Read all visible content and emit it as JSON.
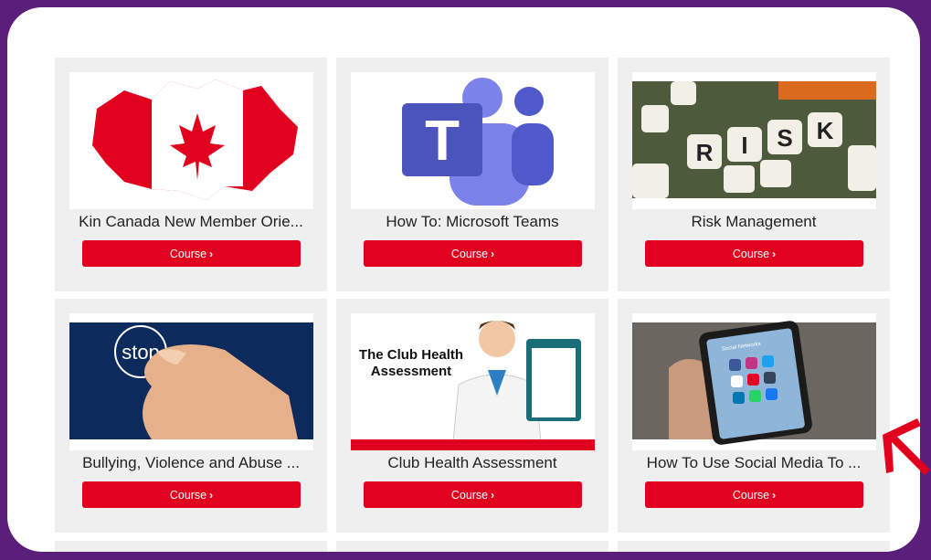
{
  "cards": [
    {
      "title": "Kin Canada New Member Orie...",
      "button": "Course",
      "thumb_icon": "canada-map-flag-image"
    },
    {
      "title": "How To: Microsoft Teams",
      "button": "Course",
      "thumb_icon": "microsoft-teams-logo-image"
    },
    {
      "title": "Risk Management",
      "button": "Course",
      "thumb_icon": "risk-dice-image"
    },
    {
      "title": "Bullying, Violence and Abuse ...",
      "button": "Course",
      "thumb_icon": "stop-finger-image"
    },
    {
      "title": "Club Health Assessment",
      "button": "Course",
      "thumb_icon": "doctor-clipboard-image"
    },
    {
      "title": "How To Use Social Media To ...",
      "button": "Course",
      "thumb_icon": "social-media-phone-image"
    }
  ],
  "thumb_text": {
    "stop": "stop",
    "club_health_line1": "The Club Health",
    "club_health_line2": "Assessment",
    "dice_letters": [
      "R",
      "I",
      "S",
      "K"
    ],
    "teams_letter": "T",
    "phone_header": "Social Networks"
  },
  "colors": {
    "accent": "#e1001e",
    "frame": "#5a1f7a",
    "card_bg": "#efefef"
  }
}
